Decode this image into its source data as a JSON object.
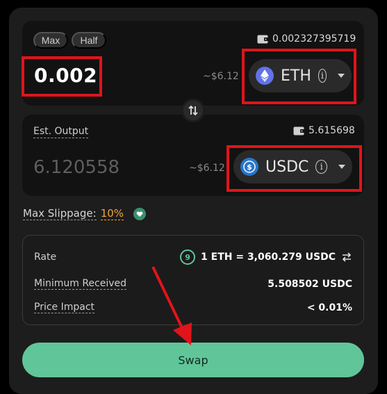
{
  "from": {
    "max_label": "Max",
    "half_label": "Half",
    "balance": "0.002327395719",
    "amount": "0.002",
    "usd_value": "~$6.12",
    "token": "ETH"
  },
  "to": {
    "label": "Est. Output",
    "balance": "5.615698",
    "amount": "6.120558",
    "usd_value": "~$6.12",
    "token": "USDC"
  },
  "slippage": {
    "label": "Max Slippage:",
    "value": "10%"
  },
  "details": {
    "rate_label": "Rate",
    "rate_timer": "9",
    "rate_value": "1 ETH = 3,060.279 USDC",
    "min_received_label": "Minimum Received",
    "min_received_value": "5.508502 USDC",
    "price_impact_label": "Price Impact",
    "price_impact_value": "< 0.01%"
  },
  "swap_button": "Swap",
  "icons": {
    "wallet": "wallet-icon",
    "eth": "eth-logo-icon",
    "usdc": "usdc-logo-icon",
    "info": "info-icon",
    "caret": "chevron-down-icon",
    "swap_direction": "swap-vertical-icon",
    "refresh": "refresh-timer-icon",
    "invert": "invert-rate-icon",
    "shield": "shield-icon"
  },
  "colors": {
    "accent": "#61c59a",
    "slippage": "#f3a43b",
    "annotation": "#e0141b",
    "eth": "#6272e8",
    "usdc": "#2775ca"
  }
}
